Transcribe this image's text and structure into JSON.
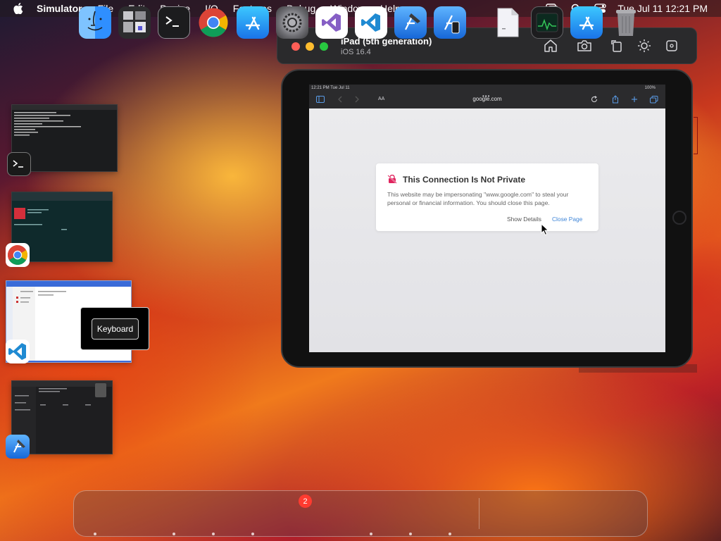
{
  "menubar": {
    "app_name": "Simulator",
    "items": [
      "File",
      "Edit",
      "Device",
      "I/O",
      "Features",
      "Debug",
      "Window",
      "Help"
    ],
    "clock": "Tue Jul 11  12:21 PM",
    "status_icons": [
      "screen-mirroring-icon",
      "spotlight-search-icon",
      "control-center-icon"
    ]
  },
  "simulator": {
    "device_name": "iPad (5th generation)",
    "os_version": "iOS 16.4",
    "toolbar_icons": [
      "home-icon",
      "screenshot-icon",
      "rotate-icon",
      "appearance-icon",
      "more-options-icon"
    ],
    "ipad": {
      "status_time": "12:21 PM  Tue Jul 11",
      "status_battery": "100%",
      "url": "google.com",
      "reader_label": "AA",
      "alert": {
        "title": "This Connection Is Not Private",
        "body": "This website may be impersonating \"www.google.com\" to steal your personal or financial information. You should close this page.",
        "show_details": "Show Details",
        "close_page": "Close Page"
      }
    }
  },
  "switcher": {
    "keyboard_label": "Keyboard",
    "apps": [
      "Terminal",
      "Google Chrome",
      "Visual Studio Code",
      "Xcode"
    ]
  },
  "dock": {
    "apps": [
      "Finder",
      "Preview",
      "Terminal",
      "Google Chrome",
      "App Store",
      "System Settings",
      "Visual Studio",
      "Visual Studio Code",
      "Xcode",
      "Simulator",
      "Document",
      "Activity Monitor",
      "App Store Download",
      "Trash"
    ],
    "settings_badge": "2"
  },
  "colors": {
    "close_page_link": "#3f86d8",
    "badge": "#ff3b30"
  }
}
